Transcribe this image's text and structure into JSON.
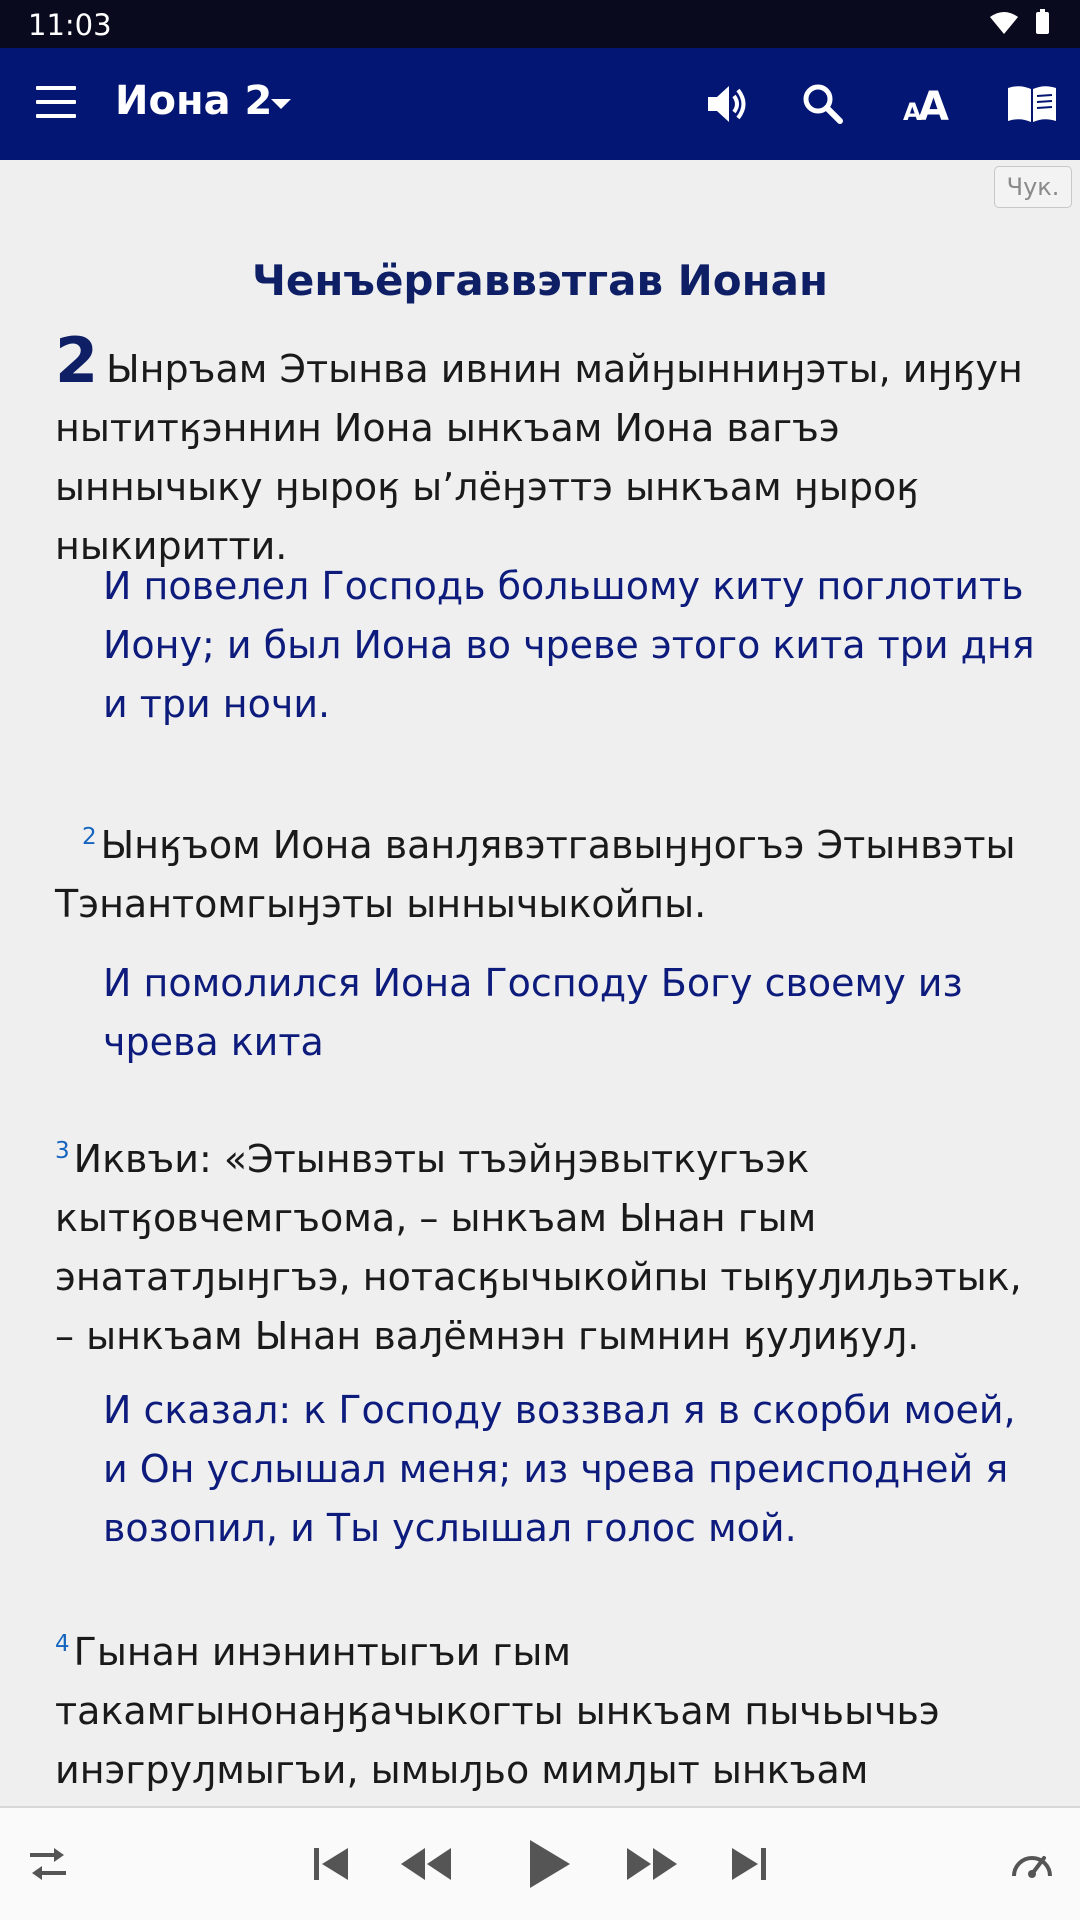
{
  "status_bar": {
    "time": "11:03"
  },
  "app_bar": {
    "book_title": "Иона 2",
    "icons": [
      "menu-icon",
      "dropdown-icon",
      "speaker-icon",
      "search-icon",
      "text-size-icon",
      "book-icon"
    ]
  },
  "language_badge": "Чук.",
  "passage": {
    "heading": "Ченъёргаввэтгав Ионан",
    "chapter_number": "2",
    "intro_original": "Ынръам Этынва ивнин майӈынниӈэты, иӈӄун нытитӄэннин Иона ынкъам Иона вагъэ ыннычыку ӈыроӄ ыʼлёӈэттэ ынкъам ӈыроӄ ныкиритти.",
    "intro_translation": "И повелел Господь большому киту поглотить Иону; и был Иона во чреве этого кита три дня и три ночи.",
    "verses": [
      {
        "number": "2",
        "original": "Ынӄъом Иона ванԓявэтгавыӈӈогъэ Этынвэты Тэнантомгыӈэты ыннычыкойпы.",
        "translation": "И помолился Иона Господу Богу своему из чрева кита"
      },
      {
        "number": "3",
        "original": "Иквъи: «Этынвэты тъэйӈэвыткугъэк кытӄовчемгъома, – ынкъам Ынан гым энататԓыӈгъэ, нотасӄычыкойпы тыӄуԓиԓьэтык, – ынкъам Ынан ваԓёмнэн гымнин ӄуԓиӄуԓ.",
        "translation": "И сказал: к Господу воззвал я в скорби моей, и Он услышал меня; из чрева преисподней я возопил, и Ты услышал голос мой."
      },
      {
        "number": "4",
        "original": "Гынан инэнинтыгъи гым такамгынонаӈӄачыкогты ынкъам пычьычьэ инэгруԓмыгъи, ымыԓьо мимԓыт ынкъам эйычгит",
        "translation": ""
      }
    ]
  },
  "player": {
    "icons": [
      "repeat-icon",
      "skip-previous-icon",
      "rewind-icon",
      "play-icon",
      "fast-forward-icon",
      "skip-next-icon",
      "speed-icon"
    ]
  },
  "colors": {
    "app_bar": "#041673",
    "heading": "#0f1f66",
    "translation_text": "#0d1c7c",
    "verse_number": "#1565c0",
    "background": "#efefef"
  }
}
